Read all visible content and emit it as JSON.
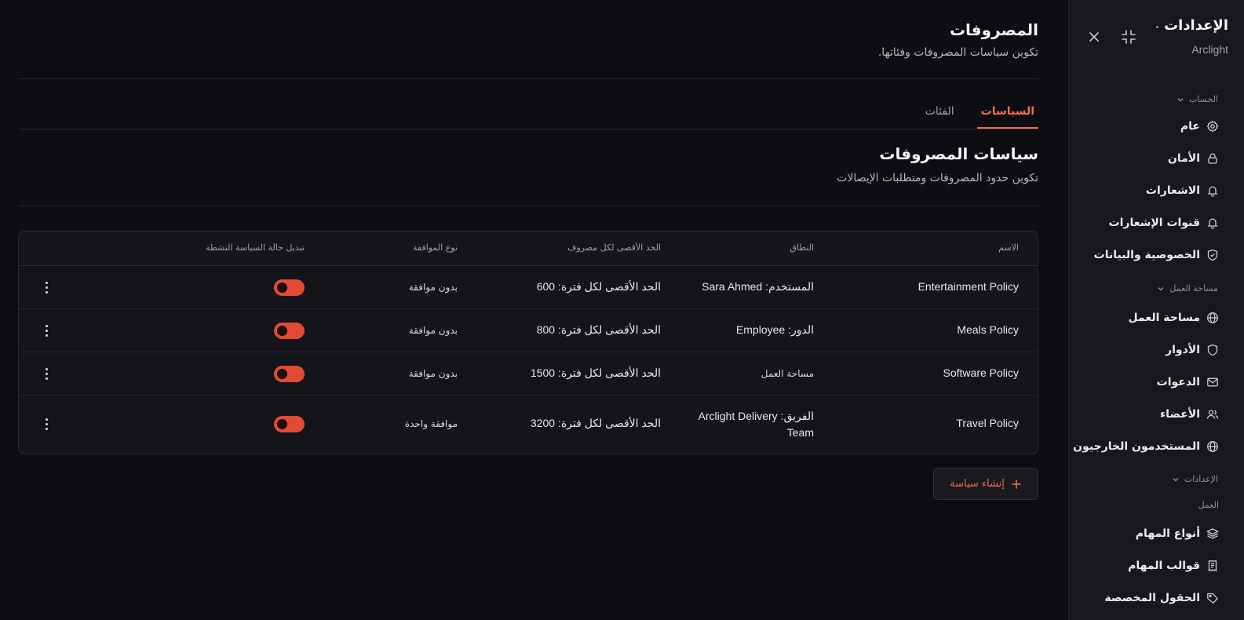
{
  "sidebar": {
    "title": "الإعدادات",
    "subtitle": "Arclight",
    "sections": {
      "account": "الحساب",
      "workspace": "مساحة العمل",
      "settings": "الإعدادات",
      "work": "العمل"
    },
    "items": [
      {
        "label": "عام",
        "icon": "gear-icon"
      },
      {
        "label": "الأمان",
        "icon": "lock-icon"
      },
      {
        "label": "الاشعارات",
        "icon": "bell-icon"
      },
      {
        "label": "قنوات الإشعارات",
        "icon": "bell-icon"
      },
      {
        "label": "الخصوصية والبيانات",
        "icon": "shield-icon"
      },
      {
        "label": "مساحة العمل",
        "icon": "globe-icon"
      },
      {
        "label": "الأدوار",
        "icon": "shield-icon"
      },
      {
        "label": "الدعوات",
        "icon": "mail-icon"
      },
      {
        "label": "الأعضاء",
        "icon": "users-icon"
      },
      {
        "label": "المستخدمون الخارجيون",
        "icon": "globe-icon"
      },
      {
        "label": "أنواع المهام",
        "icon": "layers-icon"
      },
      {
        "label": "قوالب المهام",
        "icon": "template-icon"
      },
      {
        "label": "الحقول المخصصة",
        "icon": "tag-icon"
      }
    ]
  },
  "header": {
    "title": "المصروفات",
    "subtitle": "تكوين سياسات المصروفات وفئاتها."
  },
  "tabs": [
    {
      "label": "السياسات",
      "active": true
    },
    {
      "label": "الفئات",
      "active": false
    }
  ],
  "section": {
    "title": "سياسات المصروفات",
    "subtitle": "تكوين حدود المصروفات ومتطلبات الإيصالات"
  },
  "table": {
    "columns": {
      "name": "الاسم",
      "scope": "النطاق",
      "max": "الحد الأقصى لكل مصروف",
      "approval": "نوع الموافقة",
      "toggle": "تبديل حالة السياسة النشطة"
    },
    "rows": [
      {
        "name": "Entertainment Policy",
        "scope": "المستخدم: Sara Ahmed",
        "max": "الحد الأقصى لكل فترة: 600",
        "approval": "بدون موافقة",
        "active": true
      },
      {
        "name": "Meals Policy",
        "scope": "الدور: Employee",
        "max": "الحد الأقصى لكل فترة: 800",
        "approval": "بدون موافقة",
        "active": true
      },
      {
        "name": "Software Policy",
        "scope": "مساحة العمل",
        "max": "الحد الأقصى لكل فترة: 1500",
        "approval": "بدون موافقة",
        "active": true
      },
      {
        "name": "Travel Policy",
        "scope": "الفريق: Arclight Delivery Team",
        "max": "الحد الأقصى لكل فترة: 3200",
        "approval": "موافقة واحدة",
        "active": true
      }
    ]
  },
  "create_button": {
    "label": "إنشاء سياسة"
  },
  "colors": {
    "accent": "#f46d4c",
    "toggle_on": "#e34a34",
    "background": "#0d0e12",
    "sidebar": "#17181d"
  }
}
